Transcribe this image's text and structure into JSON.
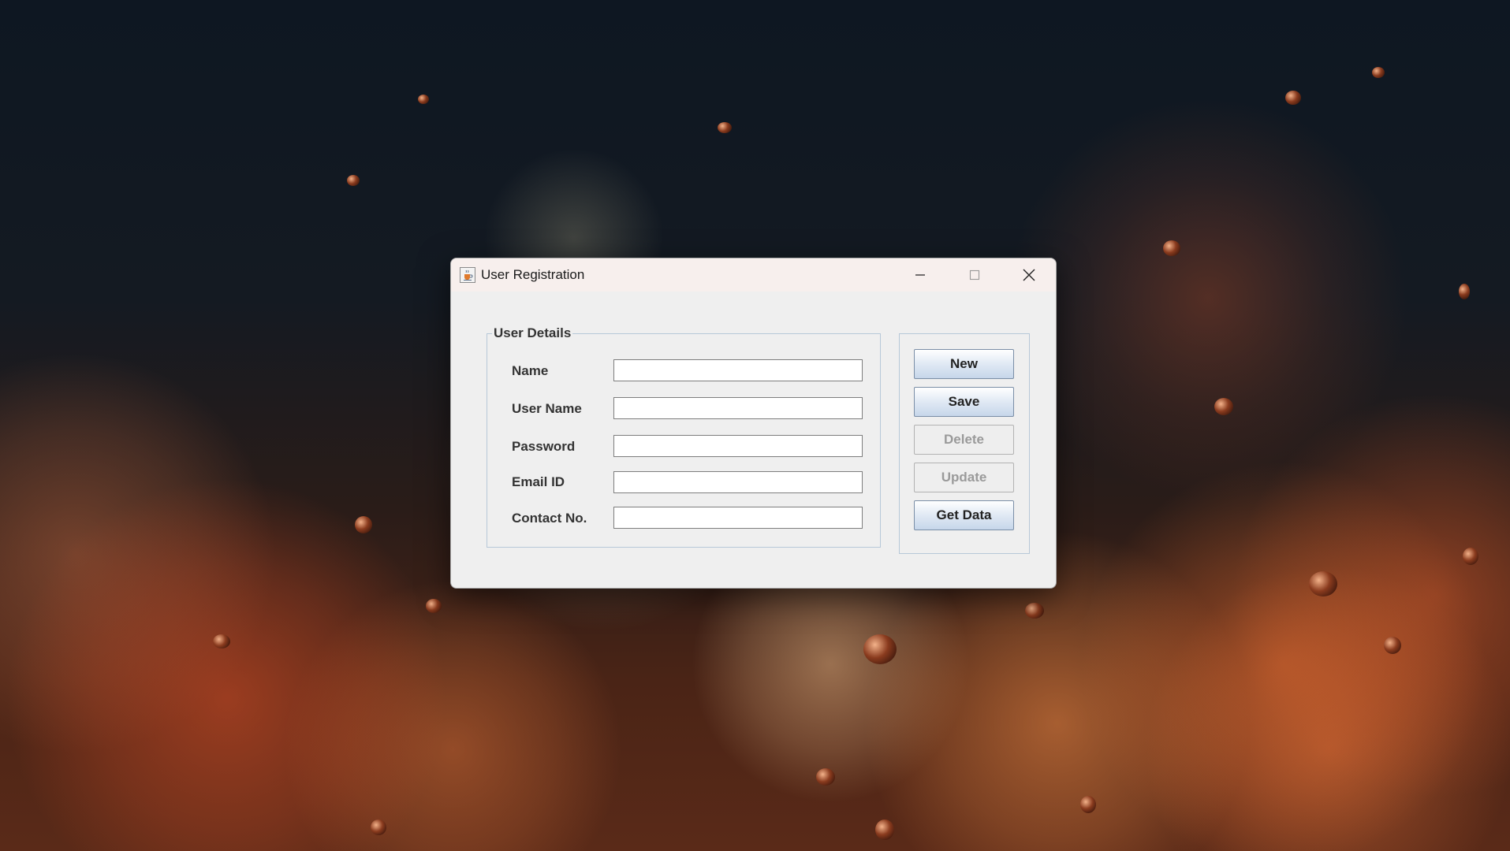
{
  "window": {
    "title": "User Registration"
  },
  "form": {
    "group_title": "User Details",
    "fields": [
      {
        "label": "Name",
        "value": ""
      },
      {
        "label": "User Name",
        "value": ""
      },
      {
        "label": "Password",
        "value": ""
      },
      {
        "label": "Email ID",
        "value": ""
      },
      {
        "label": "Contact No.",
        "value": ""
      }
    ]
  },
  "buttons": {
    "new": {
      "label": "New",
      "enabled": true
    },
    "save": {
      "label": "Save",
      "enabled": true
    },
    "delete": {
      "label": "Delete",
      "enabled": false
    },
    "update": {
      "label": "Update",
      "enabled": false
    },
    "get_data": {
      "label": "Get Data",
      "enabled": true
    }
  },
  "icons": {
    "app": "java-coffee-icon",
    "minimize": "minimize-icon",
    "maximize": "maximize-icon",
    "close": "close-icon"
  }
}
